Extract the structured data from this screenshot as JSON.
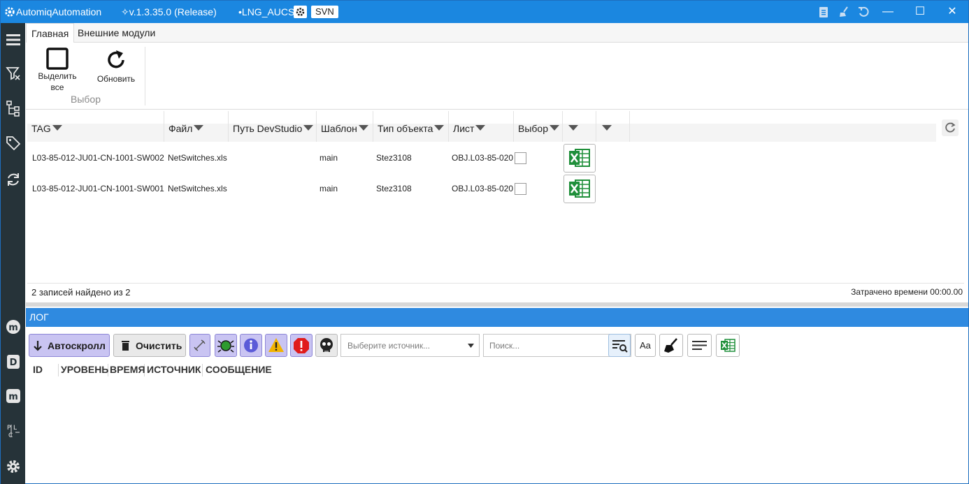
{
  "titlebar": {
    "app_name": "AutomiqAutomation",
    "version": "✧v.1.3.35.0 (Release)",
    "project": "•LNG_AUCS",
    "svn": "SVN",
    "minimize": "—",
    "maximize": "☐",
    "close": "✕"
  },
  "ribbon": {
    "tabs": [
      "Главная",
      "Внешние модули"
    ],
    "select_all_label_1": "Выделить",
    "select_all_label_2": "все",
    "refresh_label": "Обновить",
    "group_label": "Выбор"
  },
  "grid": {
    "columns": [
      "TAG",
      "Файл",
      "Путь DevStudio",
      "Шаблон",
      "Тип объекта",
      "Лист",
      "Выбор",
      "",
      ""
    ],
    "rows": [
      {
        "tag": "L03-85-012-JU01-CN-1001-SW002",
        "file": "NetSwitches.xls",
        "path": "",
        "template": "main",
        "type": "Stez3108",
        "sheet": "OBJ.L03-85-020",
        "selected": false
      },
      {
        "tag": "L03-85-012-JU01-CN-1001-SW001",
        "file": "NetSwitches.xls",
        "path": "",
        "template": "main",
        "type": "Stez3108",
        "sheet": "OBJ.L03-85-020",
        "selected": false
      }
    ],
    "footer_count": "2 записей найдено из 2",
    "footer_time": "Затрачено времени 00:00.00"
  },
  "log": {
    "title": "ЛОГ",
    "autoscroll": "Автоскролл",
    "clear": "Очистить",
    "source_placeholder": "Выберите источник...",
    "search_placeholder": "Поиск...",
    "case_label": "Aa",
    "columns": [
      "ID",
      "УРОВЕНЬ",
      "ВРЕМЯ",
      "ИСТОЧНИК",
      "СООБЩЕНИЕ"
    ]
  },
  "colors": {
    "titlebar": "#1b87e0",
    "sidebar": "#263339",
    "log_header": "#2f8ae0",
    "excel_green": "#1f8f3a"
  },
  "icons": [
    "gear-icon",
    "clipboard-icon",
    "broom-icon",
    "undo-icon",
    "menu-icon",
    "filter-icon",
    "tree-icon",
    "tags-icon",
    "sync-icon",
    "m-icon",
    "d-icon",
    "plc-icon",
    "settings-icon"
  ]
}
